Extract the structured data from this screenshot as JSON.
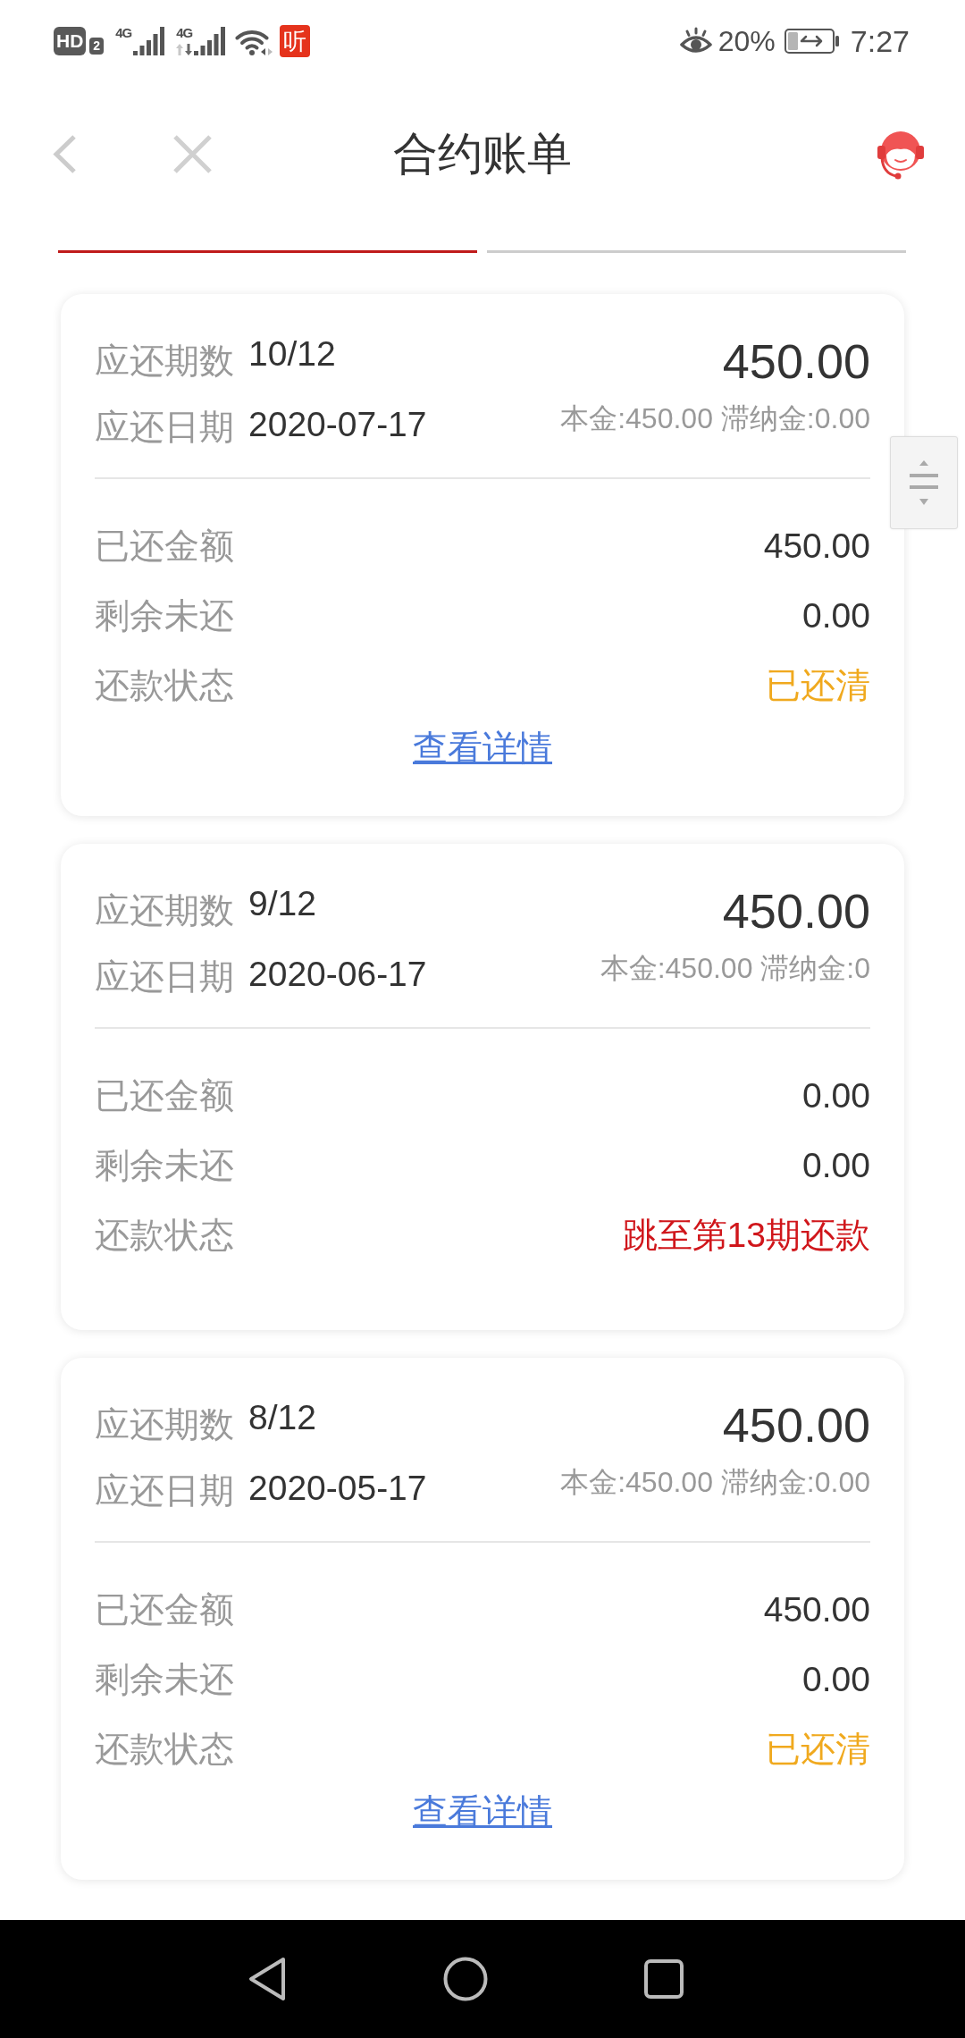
{
  "status_bar": {
    "hd_badge": "HD",
    "sim_badge": "2",
    "networks": [
      {
        "label": "4G",
        "data_arrows": false
      },
      {
        "label": "4G",
        "data_arrows": true
      }
    ],
    "app_icon": "听",
    "battery_percent": "20%",
    "time": "7:27"
  },
  "header": {
    "title": "合约账单"
  },
  "tabs": [
    {
      "selected": true
    },
    {
      "selected": false
    }
  ],
  "bills": [
    {
      "period_label": "应还期数",
      "period": "10/12",
      "amount": "450.00",
      "date_label": "应还日期",
      "date": "2020-07-17",
      "breakdown": "本金:450.00 滞纳金:0.00",
      "details": [
        {
          "label": "已还金额",
          "value": "450.00"
        },
        {
          "label": "剩余未还",
          "value": "0.00"
        }
      ],
      "status": {
        "label": "还款状态",
        "value": "已还清",
        "color": "#f0a91e"
      },
      "detail_link": "查看详情"
    },
    {
      "period_label": "应还期数",
      "period": "9/12",
      "amount": "450.00",
      "date_label": "应还日期",
      "date": "2020-06-17",
      "breakdown": "本金:450.00 滞纳金:0",
      "details": [
        {
          "label": "已还金额",
          "value": "0.00"
        },
        {
          "label": "剩余未还",
          "value": "0.00"
        }
      ],
      "status": {
        "label": "还款状态",
        "value": "跳至第13期还款",
        "color": "#d0161b"
      }
    },
    {
      "period_label": "应还期数",
      "period": "8/12",
      "amount": "450.00",
      "date_label": "应还日期",
      "date": "2020-05-17",
      "breakdown": "本金:450.00 滞纳金:0.00",
      "details": [
        {
          "label": "已还金额",
          "value": "450.00"
        },
        {
          "label": "剩余未还",
          "value": "0.00"
        }
      ],
      "status": {
        "label": "还款状态",
        "value": "已还清",
        "color": "#f0a91e"
      },
      "detail_link": "查看详情"
    }
  ]
}
